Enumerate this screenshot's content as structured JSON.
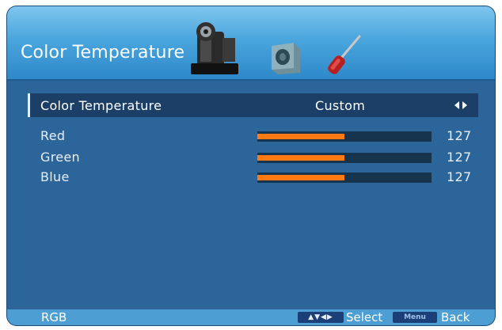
{
  "header": {
    "title": "Color Temperature",
    "icons": [
      "camcorder-icon",
      "speaker-icon",
      "screwdriver-icon"
    ]
  },
  "menu": {
    "selected_row": {
      "label": "Color Temperature",
      "value": "Custom"
    },
    "sliders": [
      {
        "label": "Red",
        "value": "127",
        "level": 0.5
      },
      {
        "label": "Green",
        "value": "127",
        "level": 0.5
      },
      {
        "label": "Blue",
        "value": "127",
        "level": 0.5
      }
    ]
  },
  "footer": {
    "left_label": "RGB",
    "nav_key_glyphs": "▲▼◀▶",
    "select_label": "Select",
    "menu_key_label": "Menu",
    "back_label": "Back"
  },
  "colors": {
    "header_gradient_top": "#7fc6ee",
    "panel_background": "#2b6599",
    "selected_row_background": "#1b3f66",
    "slider_fill": "#ff7a12",
    "slider_track": "#17344f",
    "footer_background": "#4d9fd3"
  }
}
